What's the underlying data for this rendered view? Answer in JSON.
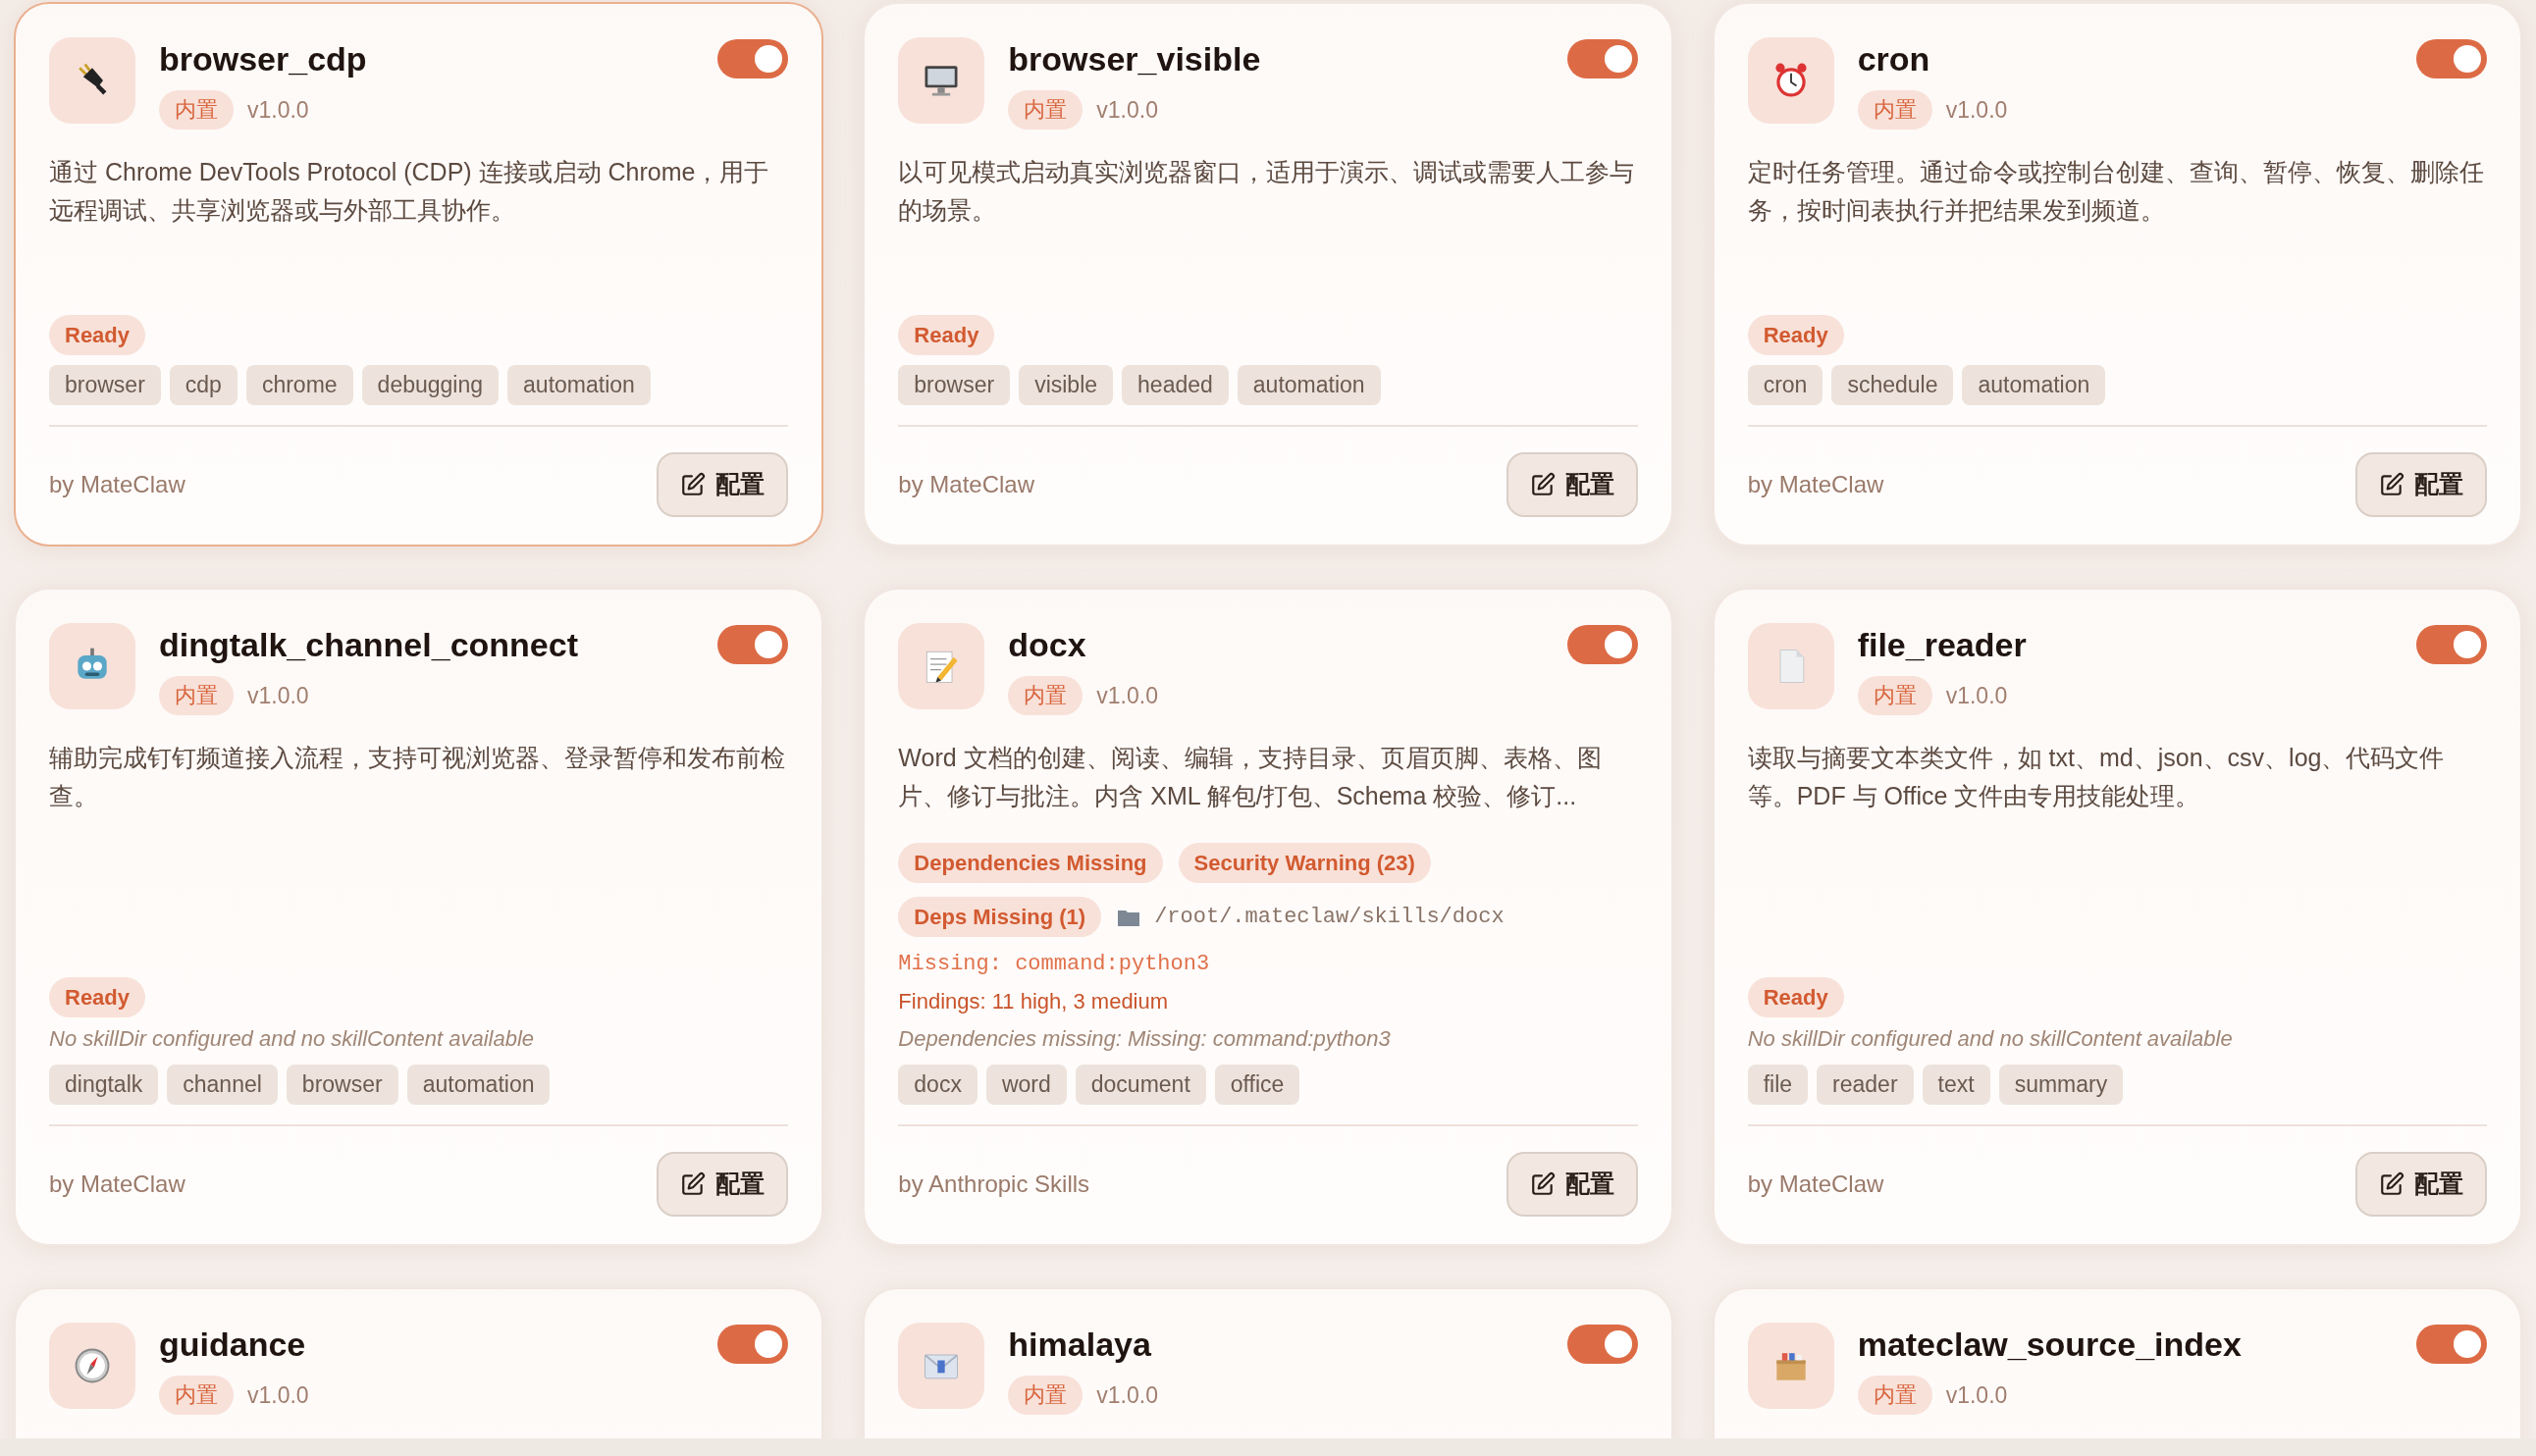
{
  "cards": [
    {
      "name": "browser_cdp",
      "builtin": "内置",
      "version": "v1.0.0",
      "enabled": true,
      "selected": true,
      "description": "通过 Chrome DevTools Protocol (CDP) 连接或启动 Chrome，用于远程调试、共享浏览器或与外部工具协作。",
      "badges": [
        "Ready"
      ],
      "tags": [
        "browser",
        "cdp",
        "chrome",
        "debugging",
        "automation"
      ],
      "author": "by MateClaw",
      "button": "配置"
    },
    {
      "name": "browser_visible",
      "builtin": "内置",
      "version": "v1.0.0",
      "enabled": true,
      "selected": false,
      "description": "以可见模式启动真实浏览器窗口，适用于演示、调试或需要人工参与的场景。",
      "badges": [
        "Ready"
      ],
      "tags": [
        "browser",
        "visible",
        "headed",
        "automation"
      ],
      "author": "by MateClaw",
      "button": "配置"
    },
    {
      "name": "cron",
      "builtin": "内置",
      "version": "v1.0.0",
      "enabled": true,
      "selected": false,
      "description": "定时任务管理。通过命令或控制台创建、查询、暂停、恢复、删除任务，按时间表执行并把结果发到频道。",
      "badges": [
        "Ready"
      ],
      "tags": [
        "cron",
        "schedule",
        "automation"
      ],
      "author": "by MateClaw",
      "button": "配置"
    },
    {
      "name": "dingtalk_channel_connect",
      "builtin": "内置",
      "version": "v1.0.0",
      "enabled": true,
      "selected": false,
      "description": "辅助完成钉钉频道接入流程，支持可视浏览器、登录暂停和发布前检查。",
      "badges": [
        "Ready"
      ],
      "note": "No skillDir configured and no skillContent available",
      "tags": [
        "dingtalk",
        "channel",
        "browser",
        "automation"
      ],
      "author": "by MateClaw",
      "button": "配置"
    },
    {
      "name": "docx",
      "builtin": "内置",
      "version": "v1.0.0",
      "enabled": true,
      "selected": false,
      "description": "Word 文档的创建、阅读、编辑，支持目录、页眉页脚、表格、图片、修订与批注。内含 XML 解包/打包、Schema 校验、修订...",
      "badges": [
        "Dependencies Missing",
        "Security Warning (23)",
        "Deps Missing (1)"
      ],
      "path": "/root/.mateclaw/skills/docx",
      "missing": "Missing: command:python3",
      "findings": "Findings: 11 high, 3 medium",
      "note": "Dependencies missing: Missing: command:python3",
      "tags": [
        "docx",
        "word",
        "document",
        "office"
      ],
      "author": "by Anthropic Skills",
      "button": "配置"
    },
    {
      "name": "file_reader",
      "builtin": "内置",
      "version": "v1.0.0",
      "enabled": true,
      "selected": false,
      "description": "读取与摘要文本类文件，如 txt、md、json、csv、log、代码文件等。PDF 与 Office 文件由专用技能处理。",
      "badges": [
        "Ready"
      ],
      "note": "No skillDir configured and no skillContent available",
      "tags": [
        "file",
        "reader",
        "text",
        "summary"
      ],
      "author": "by MateClaw",
      "button": "配置"
    },
    {
      "name": "guidance",
      "builtin": "内置",
      "version": "v1.0.0",
      "enabled": true,
      "selected": false
    },
    {
      "name": "himalaya",
      "builtin": "内置",
      "version": "v1.0.0",
      "enabled": true,
      "selected": false
    },
    {
      "name": "mateclaw_source_index",
      "builtin": "内置",
      "version": "v1.0.0",
      "enabled": true,
      "selected": false
    }
  ]
}
